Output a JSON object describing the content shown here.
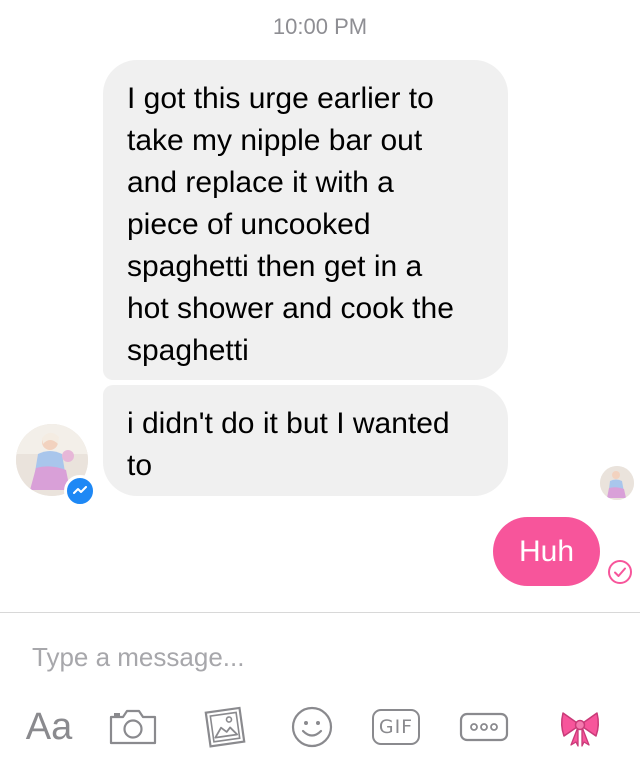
{
  "header": {
    "timestamp": "10:00 PM"
  },
  "thread": {
    "incoming": [
      {
        "text": "I got this urge earlier to\ntake my nipple bar out\nand replace it with a\npiece of uncooked\nspaghetti then get in a\nhot shower and cook the\nspaghetti"
      },
      {
        "text": "i didn't do it but I wanted\nto"
      }
    ],
    "outgoing": [
      {
        "text": "Huh",
        "status": "sent"
      }
    ]
  },
  "composer": {
    "placeholder": "Type a message..."
  },
  "toolbar": {
    "text_button_label": "Aa",
    "gif_label": "GIF",
    "icons": [
      "camera-icon",
      "gallery-icon",
      "emoji-icon",
      "gif-icon",
      "more-icon",
      "bow-icon"
    ]
  },
  "colors": {
    "incoming_bubble": "#f0f0f0",
    "outgoing_bubble": "#f7559b",
    "accent": "#f7559b",
    "messenger_blue": "#1e88f5",
    "muted_text": "#8e8e93"
  }
}
